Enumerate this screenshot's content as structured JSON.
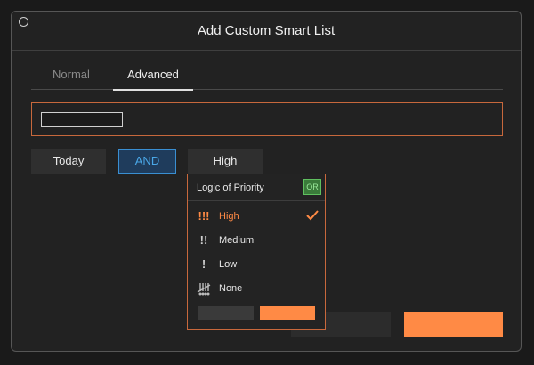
{
  "dialog": {
    "title": "Add Custom Smart List"
  },
  "tabs": [
    {
      "label": "Normal",
      "active": false
    },
    {
      "label": "Advanced",
      "active": true
    }
  ],
  "name_input": {
    "value": "",
    "placeholder": ""
  },
  "filters": {
    "date": "Today",
    "logic": "AND",
    "priority": "High"
  },
  "priority_popup": {
    "title": "Logic of Priority",
    "logic_badge": "OR",
    "items": [
      {
        "label": "High",
        "icon": "priority-high-icon",
        "glyph": "!!!",
        "color": "#ff8a45",
        "selected": true
      },
      {
        "label": "Medium",
        "icon": "priority-medium-icon",
        "glyph": "!!",
        "color": "#e8e8e8",
        "selected": false
      },
      {
        "label": "Low",
        "icon": "priority-low-icon",
        "glyph": "!",
        "color": "#e8e8e8",
        "selected": false
      },
      {
        "label": "None",
        "icon": "priority-none-icon",
        "glyph": "",
        "color": "#e8e8e8",
        "selected": false
      }
    ]
  },
  "colors": {
    "accent": "#ff8a45",
    "and_blue": "#4aa8e8",
    "or_green": "#5fbf5f",
    "border_orange": "#c8683c"
  }
}
